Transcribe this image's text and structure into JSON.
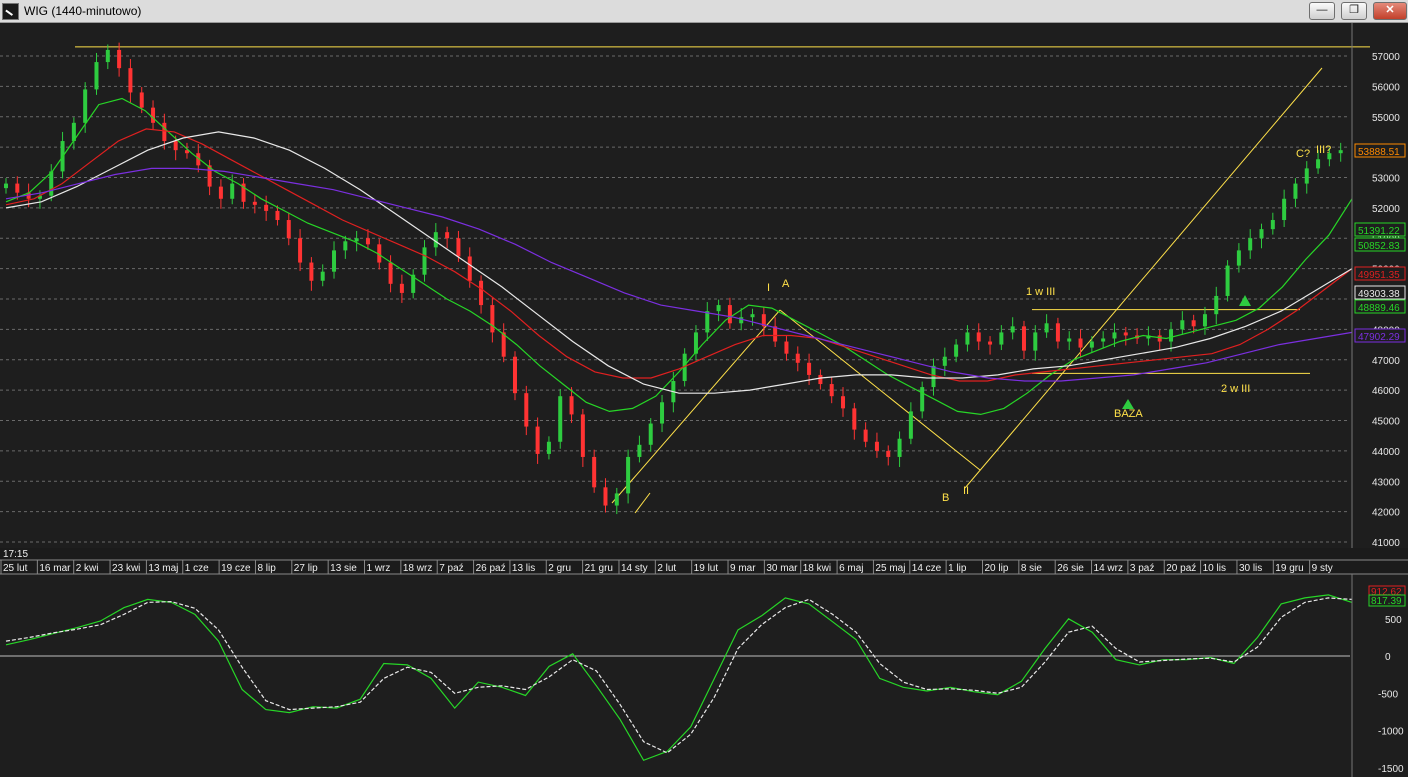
{
  "window": {
    "title": "WIG (1440-minutowo)",
    "minimize_label": "—",
    "restore_label": "❐",
    "close_label": "✕"
  },
  "time_label": "17:15",
  "colors": {
    "background": "#1e1e1e",
    "grid": "#6a6a6a",
    "candle_up": "#2ecc40",
    "candle_down": "#ff3333",
    "ma_green": "#27d627",
    "ma_red": "#e02020",
    "ma_white": "#e8e8e8",
    "ma_purple": "#7b2fe0",
    "trendline": "#ffe14a"
  },
  "chart_data": [
    {
      "type": "candlestick",
      "title": "WIG (1440-minutowo)",
      "ylim": [
        41000,
        57000
      ],
      "y_ticks": [
        41000,
        42000,
        43000,
        44000,
        45000,
        46000,
        47000,
        48000,
        49000,
        50000,
        51000,
        52000,
        53000,
        54000,
        55000,
        56000,
        57000
      ],
      "y_tick_labels": [
        "41000",
        "42000",
        "43000",
        "44000",
        "45000",
        "46000",
        "47000",
        "48000",
        "49000",
        "50000",
        "51000",
        "52000",
        "53000",
        "54000",
        "55000",
        "56000",
        "57000"
      ],
      "x_tick_labels": [
        "25 lut",
        "16 mar",
        "2 kwi",
        "23 kwi",
        "13 maj",
        "1 cze",
        "19 cze",
        "8 lip",
        "27 lip",
        "13 sie",
        "1 wrz",
        "18 wrz",
        "7 paź",
        "26 paź",
        "13 lis",
        "2 gru",
        "21 gru",
        "14 sty",
        "2 lut",
        "19 lut",
        "9 mar",
        "30 mar",
        "18 kwi",
        "6 maj",
        "25 maj",
        "14 cze",
        "1 lip",
        "20 lip",
        "8 sie",
        "26 sie",
        "14 wrz",
        "3 paź",
        "20 paź",
        "10 lis",
        "30 lis",
        "19 gru",
        "9 sty"
      ],
      "grid": true,
      "series": [
        {
          "name": "Close",
          "color": "candles",
          "values": [
            52800,
            52500,
            52300,
            52400,
            53200,
            54200,
            54800,
            55900,
            56800,
            57200,
            56600,
            55800,
            55300,
            54800,
            54200,
            53900,
            53800,
            53400,
            52700,
            52300,
            52800,
            52200,
            52100,
            51900,
            51600,
            51000,
            50200,
            49600,
            49900,
            50600,
            50900,
            51000,
            50800,
            50200,
            49500,
            49200,
            49800,
            50700,
            51200,
            51000,
            50400,
            49600,
            48800,
            47900,
            47100,
            45900,
            44800,
            43900,
            44300,
            45800,
            45200,
            43800,
            42800,
            42200,
            42600,
            43800,
            44200,
            44900,
            45600,
            46300,
            47200,
            47900,
            48600,
            48800,
            48200,
            48400,
            48500,
            48100,
            47600,
            47200,
            46900,
            46500,
            46200,
            45800,
            45400,
            44700,
            44300,
            44000,
            43800,
            44400,
            45300,
            46100,
            46800,
            47100,
            47500,
            47900,
            47600,
            47500,
            47900,
            48100,
            47300,
            47900,
            48200,
            47600,
            47700,
            47400,
            47600,
            47700,
            47900,
            47800,
            47700,
            47800,
            47600,
            48000,
            48300,
            48100,
            48500,
            49100,
            50100,
            50600,
            51000,
            51300,
            51600,
            52300,
            52800,
            53300,
            53600,
            53800,
            53900
          ]
        },
        {
          "name": "",
          "color": "#27d627",
          "values": [
            52200,
            52500,
            53200,
            54300,
            55400,
            55600,
            55200,
            54500,
            53800,
            53200,
            52800,
            52300,
            51900,
            51500,
            51200,
            50900,
            50500,
            50000,
            49500,
            49000,
            48600,
            48100,
            47500,
            46800,
            46200,
            45600,
            45300,
            45400,
            45800,
            46600,
            47500,
            48300,
            48800,
            48700,
            48300,
            47900,
            47500,
            47000,
            46500,
            46100,
            45700,
            45300,
            45200,
            45400,
            45900,
            46500,
            47000,
            47300,
            47600,
            47800,
            47700,
            47900,
            48100,
            48300,
            48700,
            49400,
            50300,
            51100,
            52300
          ]
        },
        {
          "name": "",
          "color": "#e02020",
          "values": [
            52100,
            52300,
            52800,
            53500,
            54200,
            54600,
            54500,
            54100,
            53600,
            53100,
            52600,
            52100,
            51600,
            51200,
            50800,
            50400,
            49900,
            49300,
            48600,
            47800,
            47100,
            46600,
            46400,
            46400,
            46700,
            47100,
            47500,
            47800,
            47800,
            47700,
            47400,
            47100,
            46800,
            46500,
            46300,
            46300,
            46500,
            46600,
            46700,
            46800,
            46900,
            47000,
            47100,
            47200,
            47500,
            48000,
            48600,
            49300,
            50000
          ]
        },
        {
          "name": "",
          "color": "#e8e8e8",
          "values": [
            52000,
            52200,
            52700,
            53300,
            53900,
            54300,
            54500,
            54300,
            53900,
            53300,
            52600,
            51800,
            51000,
            50200,
            49400,
            48500,
            47600,
            46800,
            46200,
            45900,
            45900,
            46000,
            46200,
            46400,
            46500,
            46500,
            46400,
            46400,
            46500,
            46700,
            46800,
            47000,
            47200,
            47400,
            47700,
            48100,
            48600,
            49300,
            50000
          ]
        },
        {
          "name": "",
          "color": "#7b2fe0",
          "values": [
            52300,
            52500,
            52800,
            53100,
            53300,
            53300,
            53200,
            53000,
            52800,
            52600,
            52300,
            52000,
            51700,
            51300,
            50800,
            50200,
            49700,
            49200,
            48800,
            48600,
            48400,
            48100,
            47800,
            47500,
            47200,
            46900,
            46600,
            46400,
            46300,
            46300,
            46400,
            46500,
            46700,
            46900,
            47200,
            47500,
            47700,
            47900
          ]
        }
      ],
      "last_value_tags": [
        {
          "label": "53888.51",
          "value": 53888.51,
          "color": "#ff8a00"
        },
        {
          "label": "51391.22",
          "value": 51391.22,
          "color": "#27d627"
        },
        {
          "label": "50852.83",
          "value": 50852.83,
          "color": "#27d627"
        },
        {
          "label": "49951.35",
          "value": 49951.35,
          "color": "#e02020"
        },
        {
          "label": "49303.38",
          "value": 49303.38,
          "color": "#e8e8e8"
        },
        {
          "label": "48889.46",
          "value": 48889.46,
          "color": "#27d627"
        },
        {
          "label": "47902.29",
          "value": 47902.29,
          "color": "#7b2fe0"
        }
      ],
      "horizontal_lines": [
        {
          "value": 57300,
          "color": "#ffe14a"
        },
        {
          "value": 48650,
          "color": "#ffe14a"
        },
        {
          "value": 46550,
          "color": "#ffe14a"
        }
      ],
      "annotations": [
        "I",
        "A",
        "B",
        "II",
        "1 w III",
        "2 w III",
        "BAZA",
        "C?",
        "III?"
      ]
    },
    {
      "type": "line",
      "title": "",
      "ylim": [
        -1500,
        1000
      ],
      "y_ticks": [
        -1500,
        -1000,
        -500,
        0,
        500
      ],
      "y_tick_labels": [
        "-1500",
        "-1000",
        "-500",
        "0",
        "500"
      ],
      "series": [
        {
          "name": "",
          "color": "#27d627",
          "values": [
            150,
            220,
            300,
            380,
            470,
            650,
            760,
            720,
            560,
            200,
            -450,
            -720,
            -760,
            -680,
            -700,
            -580,
            -100,
            -120,
            -300,
            -700,
            -350,
            -420,
            -530,
            -140,
            30,
            -400,
            -850,
            -1400,
            -1280,
            -950,
            -300,
            350,
            540,
            780,
            700,
            460,
            220,
            -300,
            -420,
            -470,
            -420,
            -480,
            -520,
            -340,
            100,
            500,
            320,
            -50,
            -120,
            -50,
            -50,
            -20,
            -100,
            250,
            700,
            780,
            820,
            720
          ]
        },
        {
          "name": "",
          "color": "#e8e8e8",
          "values": [
            200,
            250,
            310,
            360,
            420,
            560,
            720,
            730,
            640,
            350,
            -150,
            -600,
            -720,
            -700,
            -680,
            -620,
            -300,
            -150,
            -220,
            -500,
            -420,
            -400,
            -450,
            -280,
            -50,
            -200,
            -650,
            -1150,
            -1300,
            -1050,
            -550,
            100,
            420,
            650,
            760,
            560,
            320,
            -100,
            -350,
            -450,
            -440,
            -460,
            -500,
            -420,
            -80,
            320,
            400,
            100,
            -80,
            -60,
            -40,
            -30,
            -80,
            120,
            520,
            720,
            780,
            760
          ]
        }
      ],
      "last_value_tags": [
        {
          "label": "912.62",
          "value": 912.62,
          "color": "#e02020"
        },
        {
          "label": "817.39",
          "value": 817.39,
          "color": "#27d627"
        }
      ]
    }
  ]
}
